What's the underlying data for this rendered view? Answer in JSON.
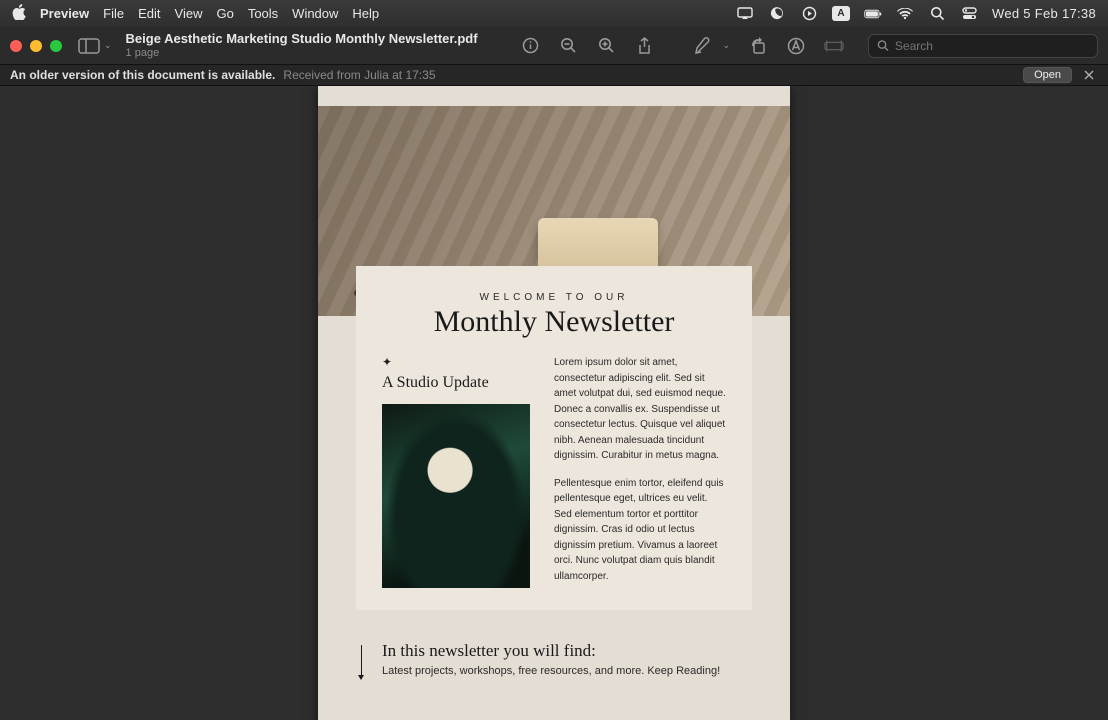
{
  "menubar": {
    "app": "Preview",
    "items": [
      "File",
      "Edit",
      "View",
      "Go",
      "Tools",
      "Window",
      "Help"
    ],
    "language_badge": "A",
    "clock": "Wed 5 Feb  17:38"
  },
  "toolbar": {
    "doc_title": "Beige Aesthetic Marketing Studio Monthly Newsletter.pdf",
    "doc_subtitle": "1 page",
    "search_placeholder": "Search"
  },
  "version_banner": {
    "message": "An older version of this document is available.",
    "detail": "Received from Julia at 17:35",
    "open_label": "Open"
  },
  "newsletter": {
    "welcome": "WELCOME TO OUR",
    "headline": "Monthly Newsletter",
    "subhead": "A Studio Update",
    "para1": "Lorem ipsum dolor sit amet, consectetur adipiscing elit. Sed sit amet volutpat dui, sed euismod neque. Donec a convallis ex. Suspendisse ut consectetur lectus. Quisque vel aliquet nibh. Aenean malesuada tincidunt dignissim. Curabitur in metus magna.",
    "para2": "Pellentesque enim tortor, eleifend quis pellentesque eget, ultrices eu velit. Sed elementum tortor et porttitor dignissim. Cras id odio ut lectus dignissim pretium. Vivamus a laoreet orci. Nunc volutpat diam quis blandit ullamcorper.",
    "footer_head": "In this newsletter you will find:",
    "footer_body": "Latest projects, workshops, free resources, and more. Keep Reading!"
  }
}
